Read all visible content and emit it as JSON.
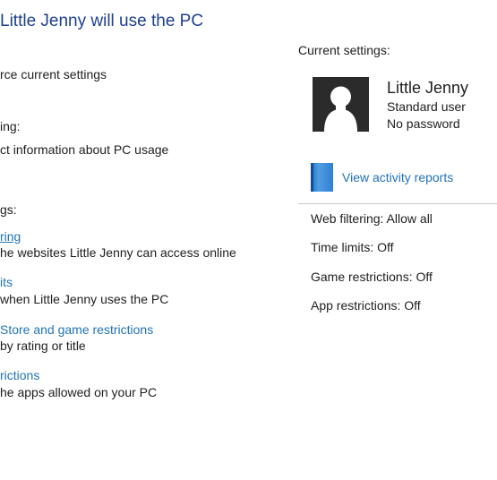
{
  "header": {
    "title": "Little Jenny will use the PC"
  },
  "left": {
    "enforce_text": "rce current settings",
    "reporting_label": "ing:",
    "reporting_text": "ct information about PC usage",
    "settings_label": "gs:",
    "items": [
      {
        "link": "ring",
        "desc": "he websites Little Jenny can access online"
      },
      {
        "link": "its",
        "desc": "when Little Jenny uses the PC"
      },
      {
        "link": "Store and game restrictions",
        "desc": "by rating or title"
      },
      {
        "link": "rictions",
        "desc": "he apps allowed on your PC"
      }
    ]
  },
  "right": {
    "current_settings_label": "Current settings:",
    "user": {
      "name": "Little Jenny",
      "type": "Standard user",
      "password": "No password"
    },
    "activity_link": "View activity reports",
    "stats": [
      "Web filtering: Allow all",
      "Time limits: Off",
      "Game restrictions: Off",
      "App restrictions: Off"
    ]
  },
  "icons": {
    "avatar": "user-silhouette-icon",
    "report": "report-book-icon"
  },
  "colors": {
    "title": "#1e3f8e",
    "link": "#1f73b9",
    "divider": "#c8c8c8"
  }
}
